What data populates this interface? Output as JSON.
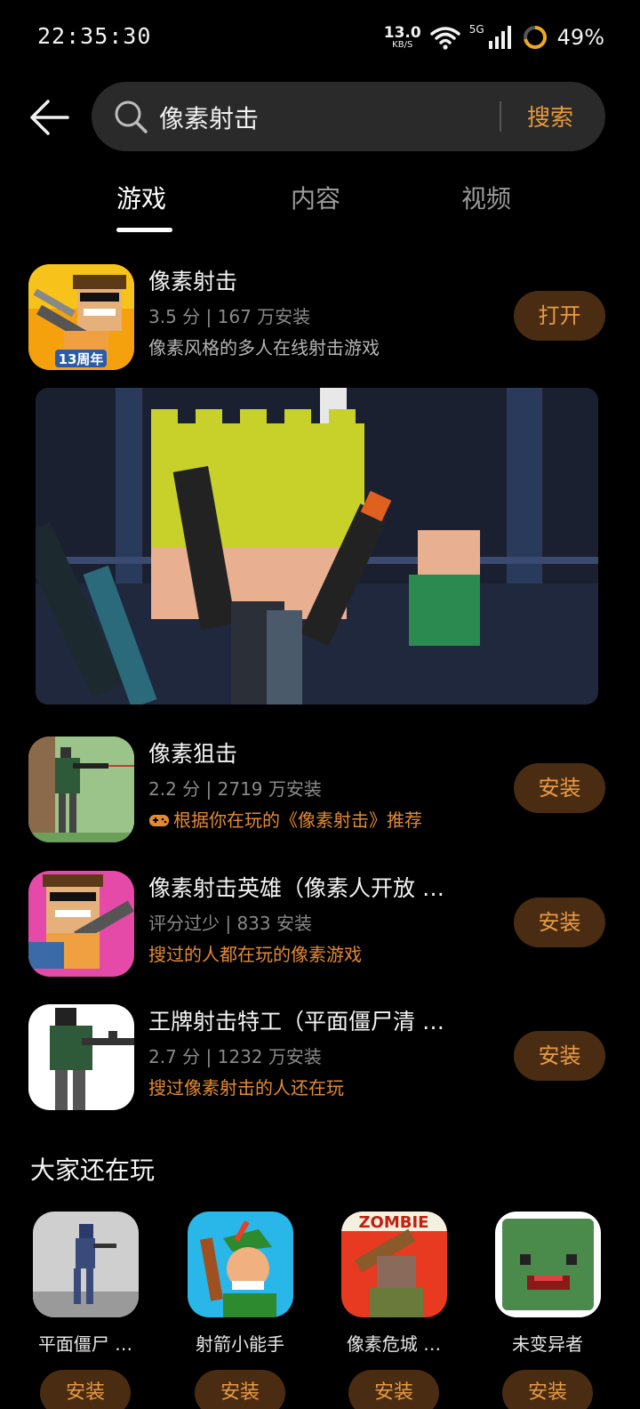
{
  "status_bar": {
    "time": "22:35:30",
    "net_speed_value": "13.0",
    "net_speed_unit": "KB/S",
    "network": "5G",
    "battery": "49%"
  },
  "search": {
    "query": "像素射击",
    "button_label": "搜索"
  },
  "tabs": [
    {
      "label": "游戏",
      "active": true
    },
    {
      "label": "内容",
      "active": false
    },
    {
      "label": "视频",
      "active": false
    }
  ],
  "results": [
    {
      "name": "像素射击",
      "meta": "3.5 分 | 167 万安装",
      "desc": "像素风格的多人在线射击游戏",
      "desc_style": "normal",
      "button": "打开",
      "icon_badge": "13周年"
    },
    {
      "name": "像素狙击",
      "meta": "2.2 分 | 2719 万安装",
      "desc": "根据你在玩的《像素射击》推荐",
      "desc_style": "orange",
      "button": "安装"
    },
    {
      "name": "像素射击英雄（像素人开放 …",
      "meta": "评分过少 | 833 安装",
      "desc": "搜过的人都在玩的像素游戏",
      "desc_style": "orange",
      "button": "安装"
    },
    {
      "name": "王牌射击特工（平面僵尸清 …",
      "meta": "2.7 分 | 1232 万安装",
      "desc": "搜过像素射击的人还在玩",
      "desc_style": "orange",
      "button": "安装"
    }
  ],
  "section": {
    "title": "大家还在玩",
    "items": [
      {
        "name": "平面僵尸 …",
        "button": "安装"
      },
      {
        "name": "射箭小能手",
        "button": "安装"
      },
      {
        "name": "像素危城 …",
        "button": "安装",
        "icon_text": "ZOMBIE"
      },
      {
        "name": "未变异者",
        "button": "安装"
      }
    ]
  },
  "colors": {
    "accent": "#e59a3c",
    "button_bg": "#4a2c12",
    "background": "#000000",
    "search_bg": "#2a2a2a"
  }
}
